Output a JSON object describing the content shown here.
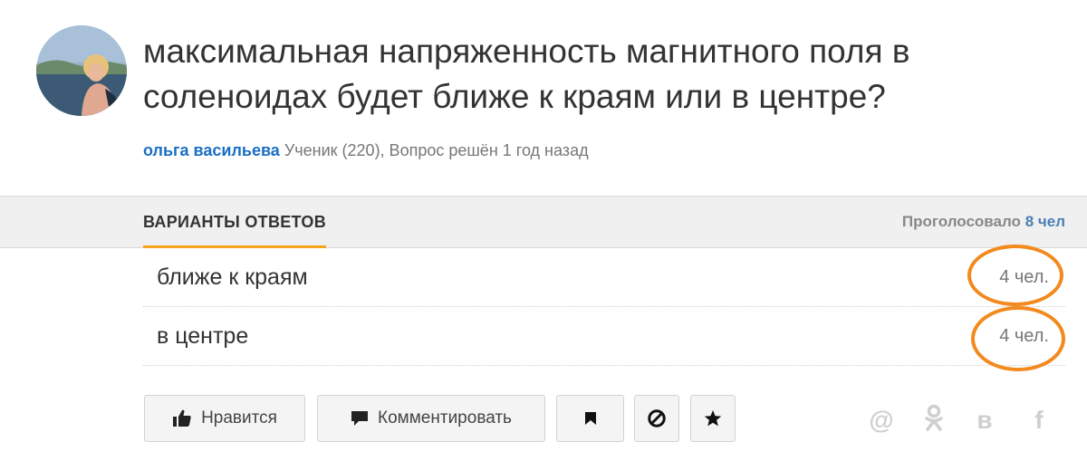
{
  "question": {
    "title": "максимальная напряженность магнитного поля в соленоидах будет ближе к краям или в центре?",
    "author": "ольга васильева",
    "meta": "Ученик (220), Вопрос решён 1 год назад"
  },
  "tabs": {
    "active_label": "ВАРИАНТЫ ОТВЕТОВ",
    "votes_prefix": "Проголосовало",
    "votes_count": "8 чел"
  },
  "options": [
    {
      "label": "ближе к краям",
      "count": "4 чел."
    },
    {
      "label": "в центре",
      "count": "4 чел."
    }
  ],
  "actions": {
    "like_label": "Нравится",
    "comment_label": "Комментировать",
    "icons": [
      "thumbs-up-icon",
      "comment-icon",
      "bookmark-icon",
      "block-icon",
      "star-icon"
    ]
  },
  "share": {
    "icons": [
      "at-sign-icon",
      "odnoklassniki-icon",
      "vk-icon",
      "facebook-icon"
    ],
    "mail_glyph": "@",
    "vk_glyph": "в",
    "fb_glyph": "f"
  },
  "colors": {
    "author_link": "#1a6fc4",
    "tab_underline": "#f7a41d",
    "highlight_circle": "#f28a1e",
    "votes_count": "#4a7fb5"
  }
}
